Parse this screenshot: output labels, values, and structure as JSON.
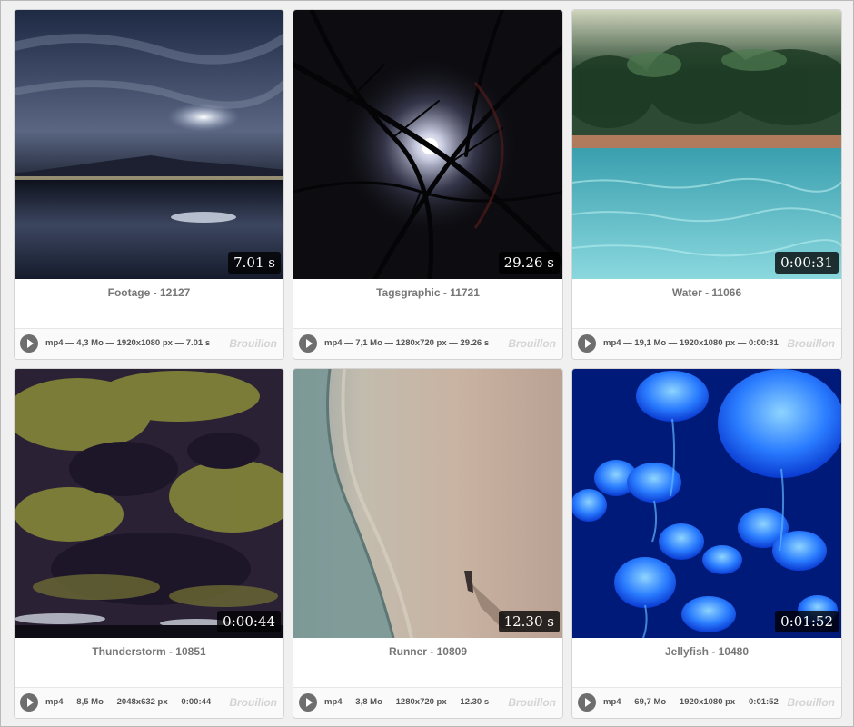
{
  "items": [
    {
      "title": "Footage - 12127",
      "duration": "7.01 s",
      "meta": "mp4 — 4,3 Mo — 1920x1080 px — 7.01 s",
      "status": "Brouillon"
    },
    {
      "title": "Tagsgraphic - 11721",
      "duration": "29.26 s",
      "meta": "mp4 — 7,1 Mo — 1280x720 px — 29.26 s",
      "status": "Brouillon"
    },
    {
      "title": "Water - 11066",
      "duration": "0:00:31",
      "meta": "mp4 — 19,1 Mo — 1920x1080 px — 0:00:31",
      "status": "Brouillon"
    },
    {
      "title": "Thunderstorm - 10851",
      "duration": "0:00:44",
      "meta": "mp4 — 8,5 Mo — 2048x632 px — 0:00:44",
      "status": "Brouillon"
    },
    {
      "title": "Runner - 10809",
      "duration": "12.30 s",
      "meta": "mp4 — 3,8 Mo — 1280x720 px — 12.30 s",
      "status": "Brouillon"
    },
    {
      "title": "Jellyfish - 10480",
      "duration": "0:01:52",
      "meta": "mp4 — 69,7 Mo — 1920x1080 px — 0:01:52",
      "status": "Brouillon"
    }
  ],
  "colors": {
    "card_bg": "#ffffff",
    "title": "#777777",
    "status": "#d4d4d4",
    "badge_bg": "#000000"
  },
  "icons": {
    "play": "play-icon"
  }
}
